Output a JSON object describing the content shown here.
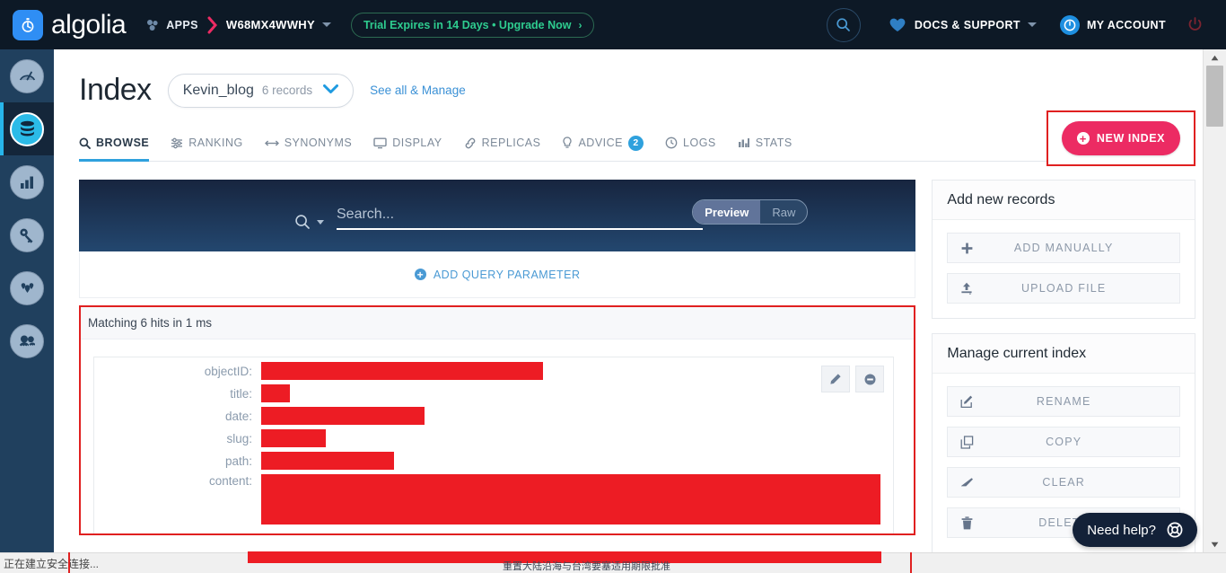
{
  "topbar": {
    "brand": "algolia",
    "apps_label": "APPS",
    "app_id": "W68MX4WWHY",
    "trial_text": "Trial Expires in 14 Days • Upgrade Now",
    "trial_arrow": "›",
    "docs_label": "DOCS & SUPPORT",
    "account_label": "MY ACCOUNT",
    "icons": {
      "search": "search-icon",
      "heart": "heart-icon",
      "account": "account-icon",
      "power": "power-icon",
      "apps": "apps-icon"
    }
  },
  "rail": {
    "items": [
      {
        "name": "dashboard",
        "icon": "gauge-icon",
        "active": false
      },
      {
        "name": "indices",
        "icon": "database-icon",
        "active": true
      },
      {
        "name": "analytics",
        "icon": "bar-chart-icon",
        "active": false
      },
      {
        "name": "api-keys",
        "icon": "key-icon",
        "active": false
      },
      {
        "name": "places",
        "icon": "map-pins-icon",
        "active": false
      },
      {
        "name": "team",
        "icon": "team-icon",
        "active": false
      }
    ]
  },
  "page": {
    "title": "Index",
    "index_name": "Kevin_blog",
    "records_count": "6 records",
    "see_all_label": "See all & Manage",
    "new_index_label": "NEW INDEX"
  },
  "tabs": [
    {
      "label": "BROWSE",
      "icon": "search-icon",
      "active": true,
      "badge": ""
    },
    {
      "label": "RANKING",
      "icon": "sliders-icon",
      "active": false,
      "badge": ""
    },
    {
      "label": "SYNONYMS",
      "icon": "arrows-icon",
      "active": false,
      "badge": ""
    },
    {
      "label": "DISPLAY",
      "icon": "monitor-icon",
      "active": false,
      "badge": ""
    },
    {
      "label": "REPLICAS",
      "icon": "link-icon",
      "active": false,
      "badge": ""
    },
    {
      "label": "ADVICE",
      "icon": "bulb-icon",
      "active": false,
      "badge": "2"
    },
    {
      "label": "LOGS",
      "icon": "clock-icon",
      "active": false,
      "badge": ""
    },
    {
      "label": "STATS",
      "icon": "bar-chart-icon",
      "active": false,
      "badge": ""
    }
  ],
  "search": {
    "placeholder": "Search...",
    "value": "",
    "toggle_preview": "Preview",
    "toggle_raw": "Raw",
    "active_toggle": "Preview",
    "add_query_parameter": "ADD QUERY PARAMETER"
  },
  "results": {
    "hits_text": "Matching 6 hits in 1 ms",
    "record_fields": [
      {
        "label": "objectID:",
        "redacted_width": 314,
        "tall": false
      },
      {
        "label": "title:",
        "redacted_width": 32,
        "tall": false
      },
      {
        "label": "date:",
        "redacted_width": 182,
        "tall": false
      },
      {
        "label": "slug:",
        "redacted_width": 72,
        "tall": false
      },
      {
        "label": "path:",
        "redacted_width": 148,
        "tall": false
      },
      {
        "label": "content:",
        "redacted_width": 690,
        "tall": true
      }
    ],
    "actions": {
      "edit": "edit-record-icon",
      "remove": "remove-record-icon"
    }
  },
  "sidebar_cards": [
    {
      "title": "Add new records",
      "buttons": [
        {
          "label": "ADD MANUALLY",
          "icon": "plus-icon"
        },
        {
          "label": "UPLOAD FILE",
          "icon": "upload-icon"
        }
      ]
    },
    {
      "title": "Manage current index",
      "buttons": [
        {
          "label": "RENAME",
          "icon": "pencil-square-icon"
        },
        {
          "label": "COPY",
          "icon": "copy-icon"
        },
        {
          "label": "CLEAR",
          "icon": "eraser-icon"
        },
        {
          "label": "DELETE",
          "icon": "trash-icon"
        }
      ]
    }
  ],
  "need_help": {
    "label": "Need help?",
    "icon": "lifebuoy-icon"
  },
  "statusbar": {
    "text": "正在建立安全连接..."
  },
  "cjk_snippet": {
    "text": "重置大陆沿海与台湾要塞适用期限批准"
  },
  "colors": {
    "brand_dark": "#0d1926",
    "rail": "#20405e",
    "accent_blue": "#2fa1dd",
    "pink": "#ec2b63",
    "redaction": "#ed1c24",
    "annotation": "#e02020",
    "trial_green": "#2ecc8f"
  }
}
